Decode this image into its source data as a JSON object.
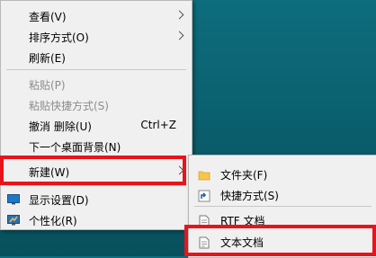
{
  "context_menu": {
    "items": [
      {
        "label": "查看(V)"
      },
      {
        "label": "排序方式(O)"
      },
      {
        "label": "刷新(E)"
      },
      {
        "label": "粘贴(P)"
      },
      {
        "label": "粘贴快捷方式(S)"
      },
      {
        "label": "撤消 删除(U)",
        "shortcut": "Ctrl+Z"
      },
      {
        "label": "下一个桌面背景(N)"
      },
      {
        "label": "新建(W)"
      },
      {
        "label": "显示设置(D)"
      },
      {
        "label": "个性化(R)"
      }
    ]
  },
  "new_submenu": {
    "items": [
      {
        "label": "文件夹(F)"
      },
      {
        "label": "快捷方式(S)"
      },
      {
        "label": "RTF 文档"
      },
      {
        "label": "文本文档"
      }
    ]
  },
  "colors": {
    "highlight": "#e8141b",
    "desktop": "#0a5d6b",
    "menu_bg": "#f0f0f0"
  }
}
